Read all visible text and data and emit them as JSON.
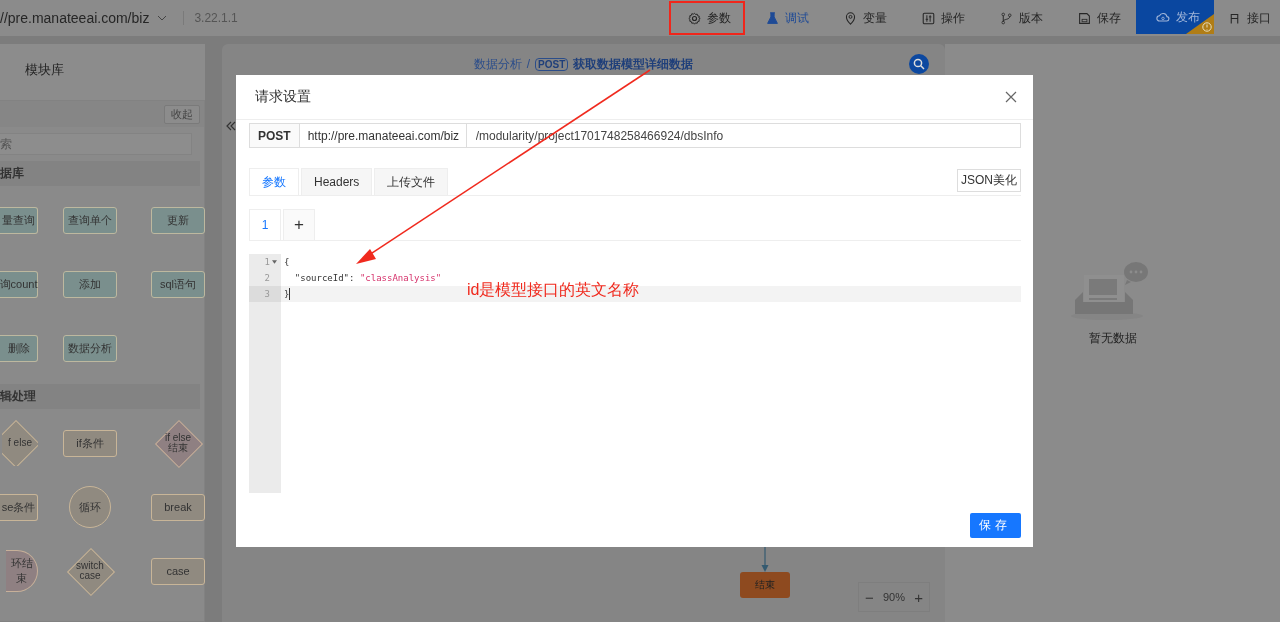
{
  "top_bar": {
    "url": "//pre.manateeai.com/biz",
    "version": "3.22.1.1",
    "actions": [
      {
        "label": "参数",
        "kind": "plain",
        "selected": false,
        "highlighted": true
      },
      {
        "label": "调试",
        "kind": "plain",
        "selected": true,
        "highlighted": false
      },
      {
        "label": "变量",
        "kind": "plain",
        "selected": false,
        "highlighted": false
      },
      {
        "label": "操作",
        "kind": "plain",
        "selected": false,
        "highlighted": false
      },
      {
        "label": "版本",
        "kind": "plain",
        "selected": false,
        "highlighted": false
      },
      {
        "label": "保存",
        "kind": "plain",
        "selected": false,
        "highlighted": false
      },
      {
        "label": "发布",
        "kind": "primary",
        "selected": false,
        "highlighted": false
      },
      {
        "label": "接口",
        "kind": "plain",
        "selected": false,
        "highlighted": false
      }
    ]
  },
  "library": {
    "title": "模块库",
    "collapse": "收起",
    "search_placeholder": "索",
    "sections": [
      {
        "title": "据库",
        "nodes": [
          {
            "label": "量查询",
            "kind": "rect",
            "color": "#7a8f8d"
          },
          {
            "label": "查询单个",
            "kind": "rect",
            "color": "#7a8f8d"
          },
          {
            "label": "更新",
            "kind": "rect",
            "color": "#7a8f8d"
          },
          {
            "label": "询count",
            "kind": "rect",
            "color": "#7a8f8d"
          },
          {
            "label": "添加",
            "kind": "rect",
            "color": "#7a8f8d"
          },
          {
            "label": "sql语句",
            "kind": "rect",
            "color": "#7a8f8d"
          },
          {
            "label": "删除",
            "kind": "rect",
            "color": "#7a8f8d"
          },
          {
            "label": "数据分析",
            "kind": "rect",
            "color": "#7a8f8d"
          }
        ]
      },
      {
        "title": "辑处理",
        "nodes": [
          {
            "label": "f else",
            "kind": "diamond",
            "color": "#908a80"
          },
          {
            "label": "if条件",
            "kind": "rect",
            "color": "#908a80"
          },
          {
            "label": "if else 结束",
            "kind": "diamond",
            "color": "#8f8082"
          },
          {
            "label": "se条件",
            "kind": "rect",
            "color": "#908a80"
          },
          {
            "label": "循环",
            "kind": "circle",
            "color": "#908a80"
          },
          {
            "label": "break",
            "kind": "rect",
            "color": "#908a80"
          },
          {
            "label": "环结束",
            "kind": "circle",
            "color": "#8f8082"
          },
          {
            "label": "switch case",
            "kind": "diamond",
            "color": "#908a80"
          },
          {
            "label": "case",
            "kind": "rect",
            "color": "#908a80"
          }
        ]
      }
    ]
  },
  "canvas": {
    "breadcrumb": "数据分析",
    "separator": "/",
    "method": "POST",
    "api_name": "获取数据模型详细数据",
    "end_node": "结束",
    "zoom": "90%",
    "zoom_out": "−",
    "zoom_in": "+"
  },
  "side_panel": {
    "empty_text": "暂无数据"
  },
  "dialog": {
    "title": "请求设置",
    "method": "POST",
    "base_url": "http://pre.manateeai.com/biz",
    "path": "/modularity/project1701748258466924/dbsInfo",
    "tabs": [
      {
        "label": "参数",
        "selected": true
      },
      {
        "label": "Headers",
        "selected": false
      },
      {
        "label": "上传文件",
        "selected": false
      }
    ],
    "beautify": "JSON美化",
    "body_tabs": [
      {
        "label": "1",
        "selected": true
      }
    ],
    "add_tab": "+",
    "code_lines": [
      {
        "number": "1",
        "foldable": true,
        "active": false,
        "tokens": [
          {
            "text": "{",
            "kind": "punct"
          }
        ]
      },
      {
        "number": "2",
        "foldable": false,
        "active": false,
        "tokens": [
          {
            "text": "  \"sourceId\"",
            "kind": "key"
          },
          {
            "text": ": ",
            "kind": "punct"
          },
          {
            "text": "\"classAnalysis\"",
            "kind": "string"
          }
        ]
      },
      {
        "number": "3",
        "foldable": false,
        "active": true,
        "tokens": [
          {
            "text": "}",
            "kind": "punct"
          }
        ]
      }
    ],
    "save": "保存"
  },
  "annotation": {
    "text": "id是模型接口的英文名称"
  }
}
